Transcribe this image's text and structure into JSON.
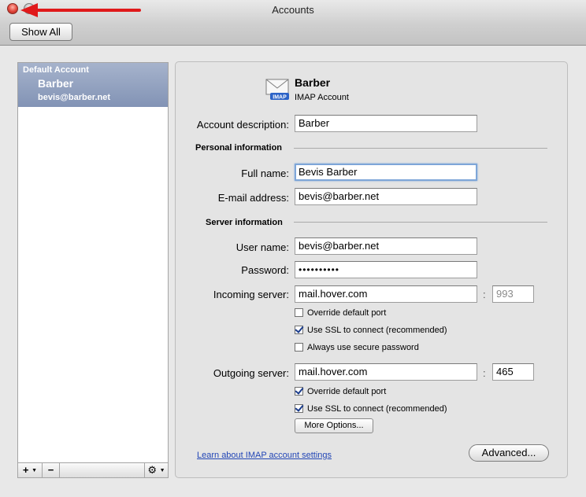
{
  "window": {
    "title": "Accounts"
  },
  "toolbar": {
    "show_all_label": "Show All"
  },
  "sidebar": {
    "group_label": "Default Account",
    "account_name": "Barber",
    "account_email": "bevis@barber.net",
    "add_label": "+",
    "remove_label": "−",
    "menu_arrow": "▼",
    "action_icon": "⚙"
  },
  "account": {
    "name": "Barber",
    "type": "IMAP Account",
    "icon_badge": "IMAP",
    "description_label": "Account description:",
    "description_value": "Barber"
  },
  "personal": {
    "section_label": "Personal information",
    "full_name_label": "Full name:",
    "full_name_value": "Bevis Barber",
    "email_label": "E-mail address:",
    "email_value": "bevis@barber.net"
  },
  "server": {
    "section_label": "Server information",
    "username_label": "User name:",
    "username_value": "bevis@barber.net",
    "password_label": "Password:",
    "password_value": "••••••••••",
    "incoming_label": "Incoming server:",
    "incoming_value": "mail.hover.com",
    "incoming_port": "993",
    "incoming_options": [
      {
        "label": "Override default port",
        "checked": false
      },
      {
        "label": "Use SSL to connect (recommended)",
        "checked": true
      },
      {
        "label": "Always use secure password",
        "checked": false
      }
    ],
    "outgoing_label": "Outgoing server:",
    "outgoing_value": "mail.hover.com",
    "outgoing_port": "465",
    "outgoing_options": [
      {
        "label": "Override default port",
        "checked": true
      },
      {
        "label": "Use SSL to connect (recommended)",
        "checked": true
      }
    ],
    "port_separator": ":",
    "more_options_label": "More Options..."
  },
  "footer": {
    "learn_link": "Learn about IMAP account settings",
    "advanced_label": "Advanced..."
  },
  "colors": {
    "selection": "#8293b5",
    "annotation_arrow": "#e0191b",
    "link": "#2246b6"
  }
}
